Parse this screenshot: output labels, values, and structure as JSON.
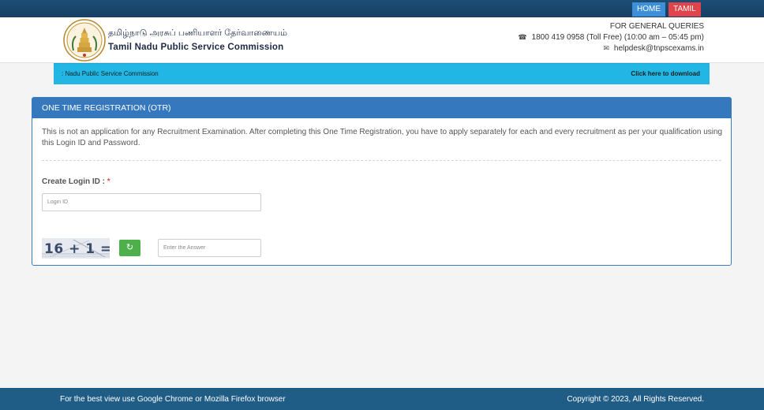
{
  "topbar": {
    "home_label": "HOME",
    "tamil_label": "TAMIL"
  },
  "header": {
    "title_tamil": "தமிழ்நாடு அரசுப் பணியாளர் தேர்வாணையம்",
    "title_english": "Tamil Nadu Public Service Commission",
    "queries_title": "FOR GENERAL QUERIES",
    "phone": "1800 419 0958 (Toll Free)  (10:00 am – 05:45 pm)",
    "email": "helpdesk@tnpscexams.in",
    "phone_icon": "phone-icon",
    "mail_icon": "envelope-icon"
  },
  "ticker": {
    "text": ": Nadu Public Service Commission",
    "link": "Click here to download"
  },
  "panel": {
    "title": "ONE TIME REGISTRATION (OTR)",
    "notice": "This is not an application for any Recruitment Examination. After completing this One Time Registration, you have to apply separately for each and every recruitment as per your qualification using this Login ID and Password.",
    "login_label": "Create Login ID :",
    "required_mark": "*",
    "login_placeholder": "Login ID",
    "captcha_text": "16 + 1 =",
    "refresh_icon": "refresh-icon",
    "answer_placeholder": "Enter the Answer"
  },
  "footer": {
    "left": "For the best view use Google Chrome or Mozilla Firefox browser",
    "right": "Copyright © 2023, All Rights Reserved."
  },
  "colors": {
    "topbar": "#1d4e76",
    "home_button": "#3d8fd8",
    "tamil_button": "#e0434a",
    "ticker": "#22b6e4",
    "panel_header": "#3578be",
    "refresh_button": "#4db04a",
    "footer": "#1f5c86"
  }
}
